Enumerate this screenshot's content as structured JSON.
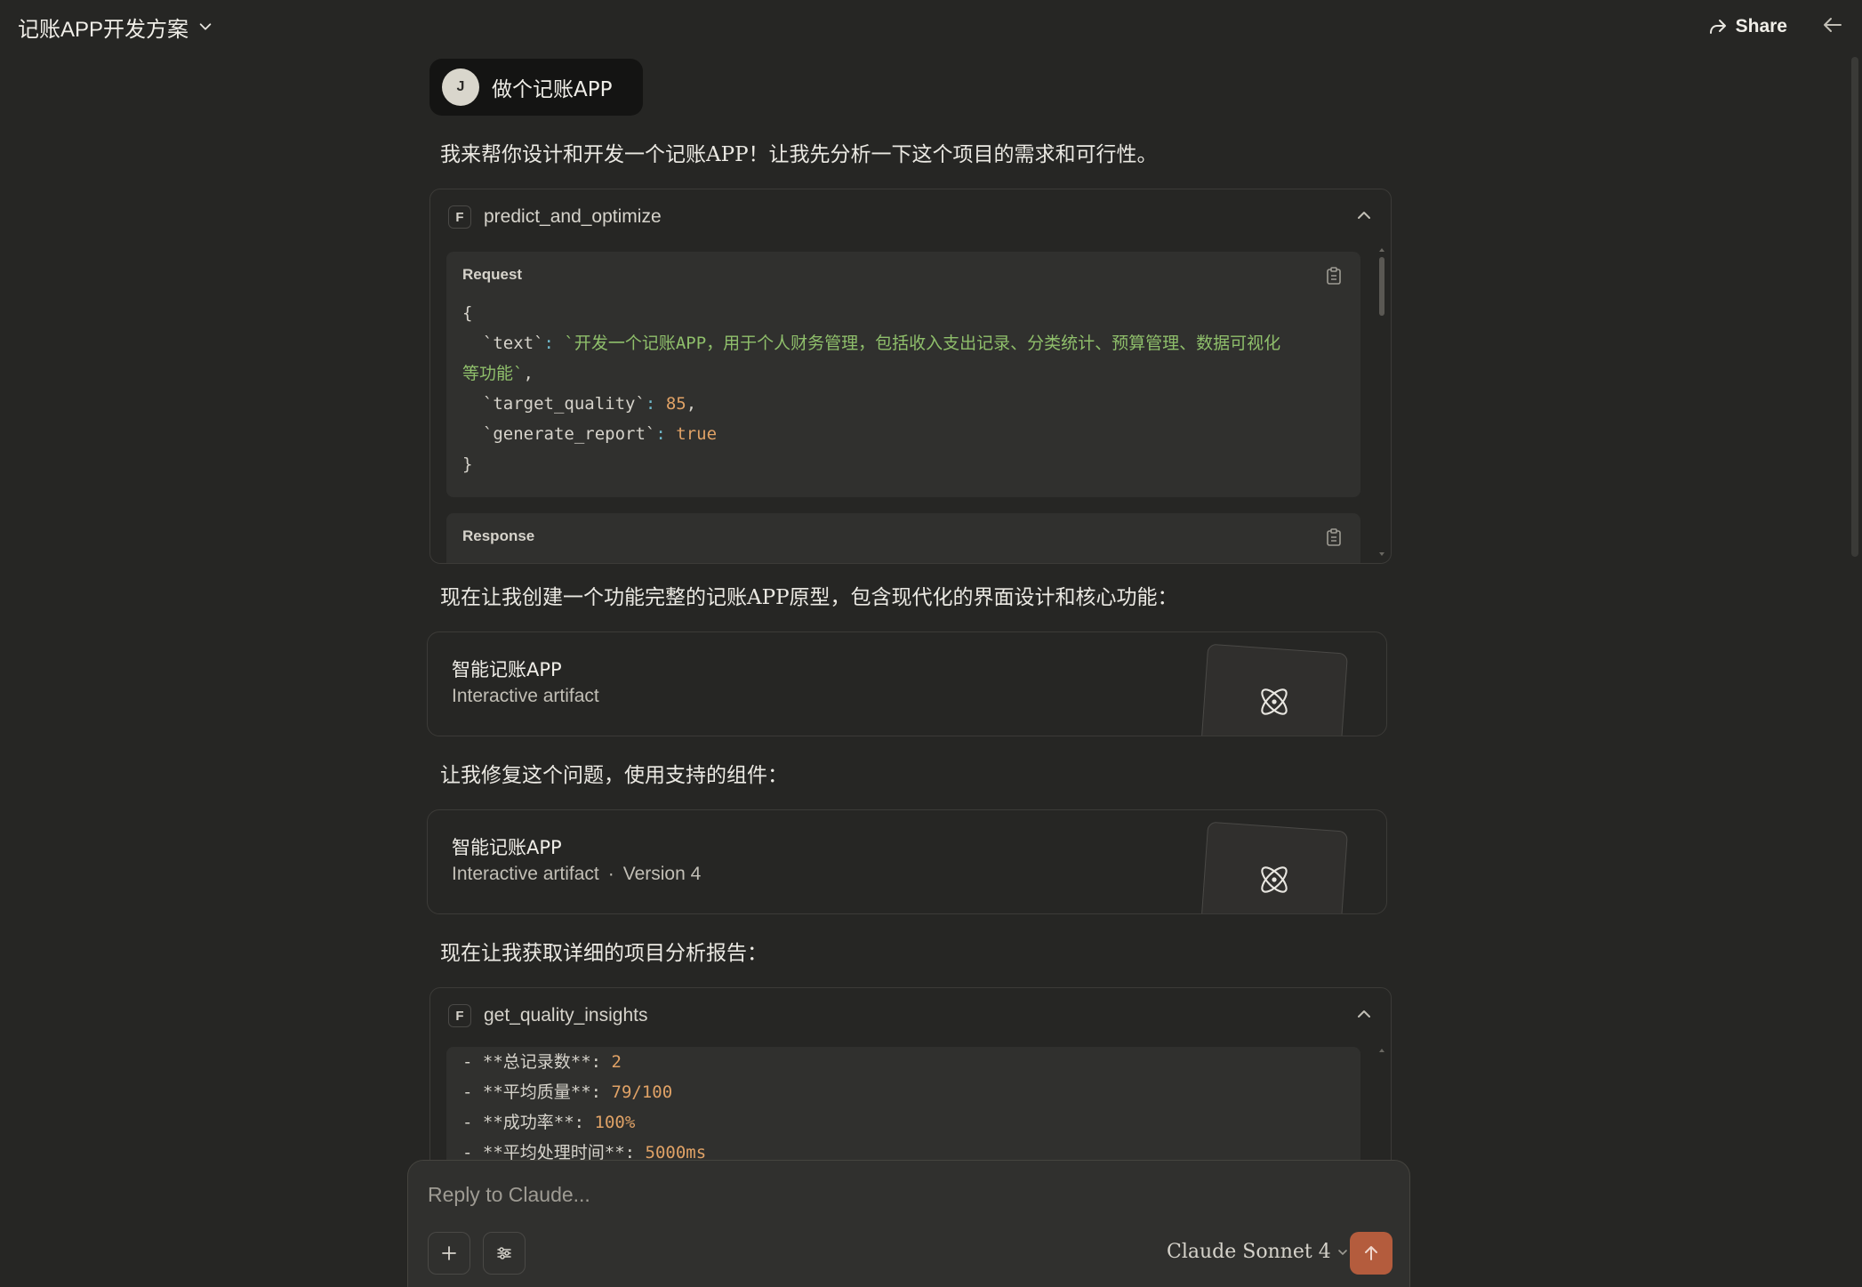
{
  "header": {
    "chat_title": "记账APP开发方案",
    "share_label": "Share"
  },
  "conversation": {
    "user_initial": "J",
    "user_message": "做个记账APP",
    "assistant_intro": "我来帮你设计和开发一个记账APP！让我先分析一下这个项目的需求和可行性。",
    "tool1": {
      "name": "predict_and_optimize",
      "request_label": "Request",
      "response_label": "Response",
      "code": {
        "open": "{",
        "text_key": "`text`",
        "text_value_line1": "`开发一个记账APP，用于个人财务管理，包括收入支出记录、分类统计、预算管理、数据可视化",
        "text_value_line2": "等功能`",
        "target_key": "`target_quality`",
        "target_value": "85",
        "report_key": "`generate_report`",
        "report_value": "true",
        "close": "}"
      }
    },
    "assistant_text2": "现在让我创建一个功能完整的记账APP原型，包含现代化的界面设计和核心功能：",
    "artifact1": {
      "title": "智能记账APP",
      "subtitle": "Interactive artifact"
    },
    "assistant_text3": "让我修复这个问题，使用支持的组件：",
    "artifact2": {
      "title": "智能记账APP",
      "subtitle": "Interactive artifact",
      "separator": "·",
      "version": "Version 4"
    },
    "assistant_text4": "现在让我获取详细的项目分析报告：",
    "tool2": {
      "name": "get_quality_insights",
      "lines": [
        {
          "label": "- **总记录数**: ",
          "value": "2"
        },
        {
          "label": "- **平均质量**: ",
          "value": "79/100"
        },
        {
          "label": "- **成功率**: ",
          "value": "100%"
        },
        {
          "label": "- **平均处理时间**: ",
          "value": "5000ms"
        }
      ]
    }
  },
  "composer": {
    "placeholder": "Reply to Claude...",
    "model": "Claude Sonnet 4"
  },
  "colors": {
    "background": "#262624",
    "send_button": "#b45c3d",
    "string": "#8fbf6b",
    "number": "#e0a266"
  }
}
